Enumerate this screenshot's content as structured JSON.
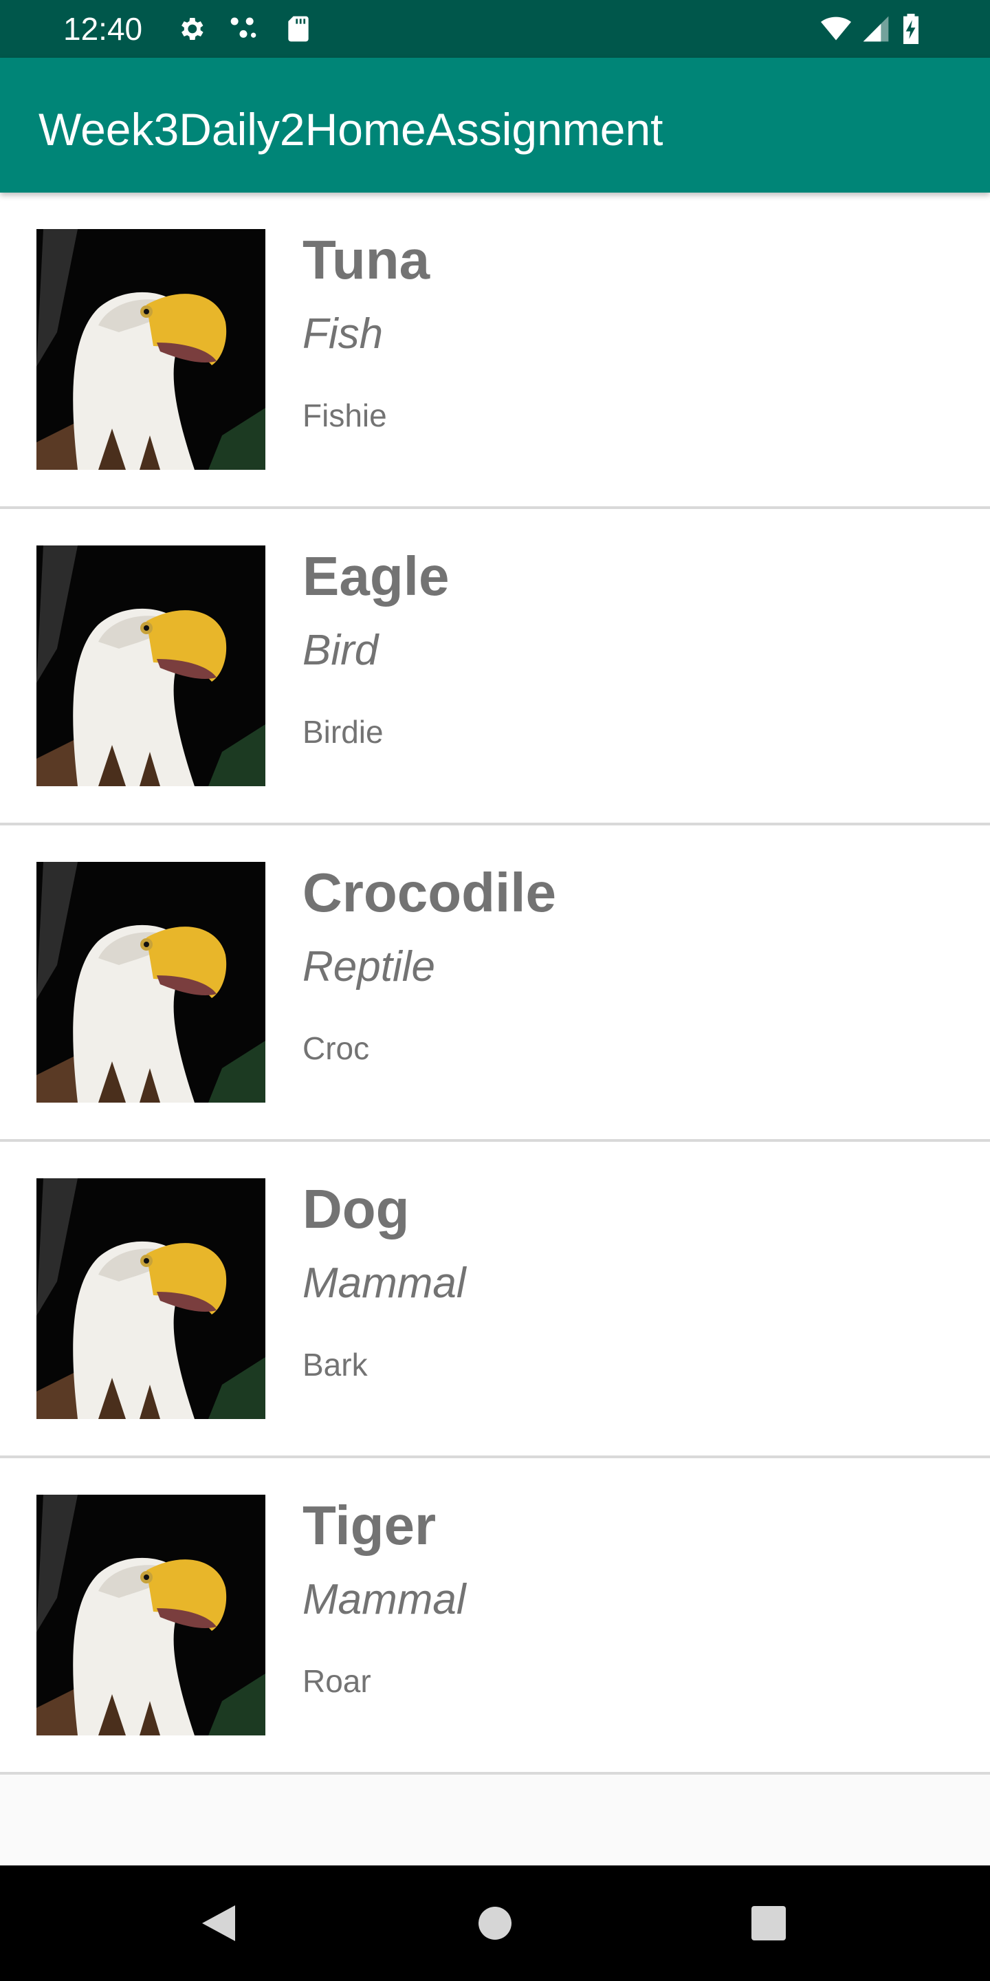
{
  "status_bar": {
    "time": "12:40",
    "icons_left": [
      "gear-icon",
      "cast-icon",
      "sd-card-icon"
    ],
    "icons_right": [
      "wifi-icon",
      "signal-icon",
      "battery-charging-icon"
    ]
  },
  "app_bar": {
    "title": "Week3Daily2HomeAssignment",
    "color": "#008577",
    "status_color": "#00574b"
  },
  "animals": [
    {
      "name": "Tuna",
      "category": "Fish",
      "nickname": "Fishie",
      "image": "bald-eagle-photo"
    },
    {
      "name": "Eagle",
      "category": "Bird",
      "nickname": "Birdie",
      "image": "bald-eagle-photo"
    },
    {
      "name": "Crocodile",
      "category": "Reptile",
      "nickname": "Croc",
      "image": "bald-eagle-photo"
    },
    {
      "name": "Dog",
      "category": "Mammal",
      "nickname": "Bark",
      "image": "bald-eagle-photo"
    },
    {
      "name": "Tiger",
      "category": "Mammal",
      "nickname": "Roar",
      "image": "bald-eagle-photo"
    }
  ],
  "nav_bar": {
    "buttons": [
      "back-icon",
      "home-icon",
      "recents-icon"
    ]
  }
}
